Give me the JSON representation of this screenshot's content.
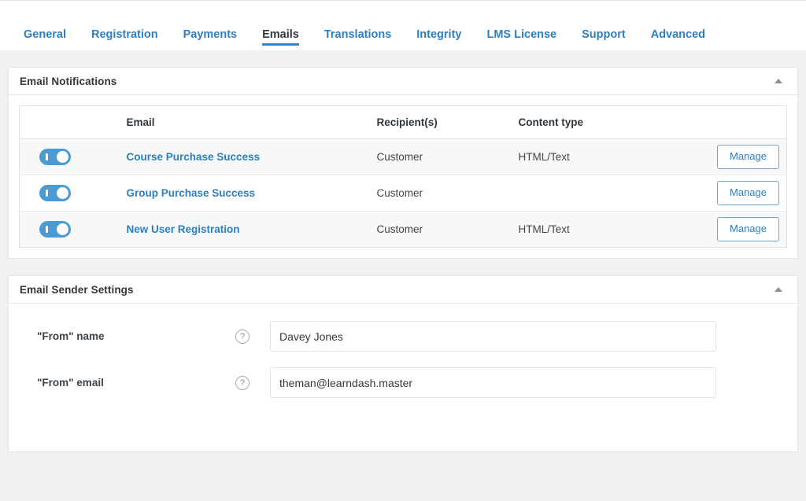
{
  "tabs": [
    {
      "label": "General",
      "active": false
    },
    {
      "label": "Registration",
      "active": false
    },
    {
      "label": "Payments",
      "active": false
    },
    {
      "label": "Emails",
      "active": true
    },
    {
      "label": "Translations",
      "active": false
    },
    {
      "label": "Integrity",
      "active": false
    },
    {
      "label": "LMS License",
      "active": false
    },
    {
      "label": "Support",
      "active": false
    },
    {
      "label": "Advanced",
      "active": false
    }
  ],
  "notifications_panel": {
    "title": "Email Notifications",
    "collapse_icon": "caret-up-icon",
    "columns": [
      "",
      "Email",
      "Recipient(s)",
      "Content type",
      ""
    ],
    "rows": [
      {
        "enabled": true,
        "toggle_state": "on",
        "email": "Course Purchase Success",
        "recipients": "Customer",
        "content_type": "HTML/Text",
        "action_label": "Manage"
      },
      {
        "enabled": true,
        "toggle_state": "on",
        "email": "Group Purchase Success",
        "recipients": "Customer",
        "content_type": "",
        "action_label": "Manage"
      },
      {
        "enabled": true,
        "toggle_state": "on",
        "email": "New User Registration",
        "recipients": "Customer",
        "content_type": "HTML/Text",
        "action_label": "Manage"
      }
    ]
  },
  "sender_panel": {
    "title": "Email Sender Settings",
    "collapse_icon": "caret-up-icon",
    "fields": [
      {
        "label": "\"From\" name",
        "help_icon": "question-mark-icon",
        "value": "Davey Jones",
        "placeholder": ""
      },
      {
        "label": "\"From\" email",
        "help_icon": "question-mark-icon",
        "value": "theman@learndash.master",
        "placeholder": ""
      }
    ]
  },
  "colors": {
    "link": "#2c7fc0",
    "accent": "#3582c4",
    "toggle_on": "#4a9ad4",
    "page_bg": "#f1f1f1",
    "row_alt_bg": "#f7f8f8"
  }
}
